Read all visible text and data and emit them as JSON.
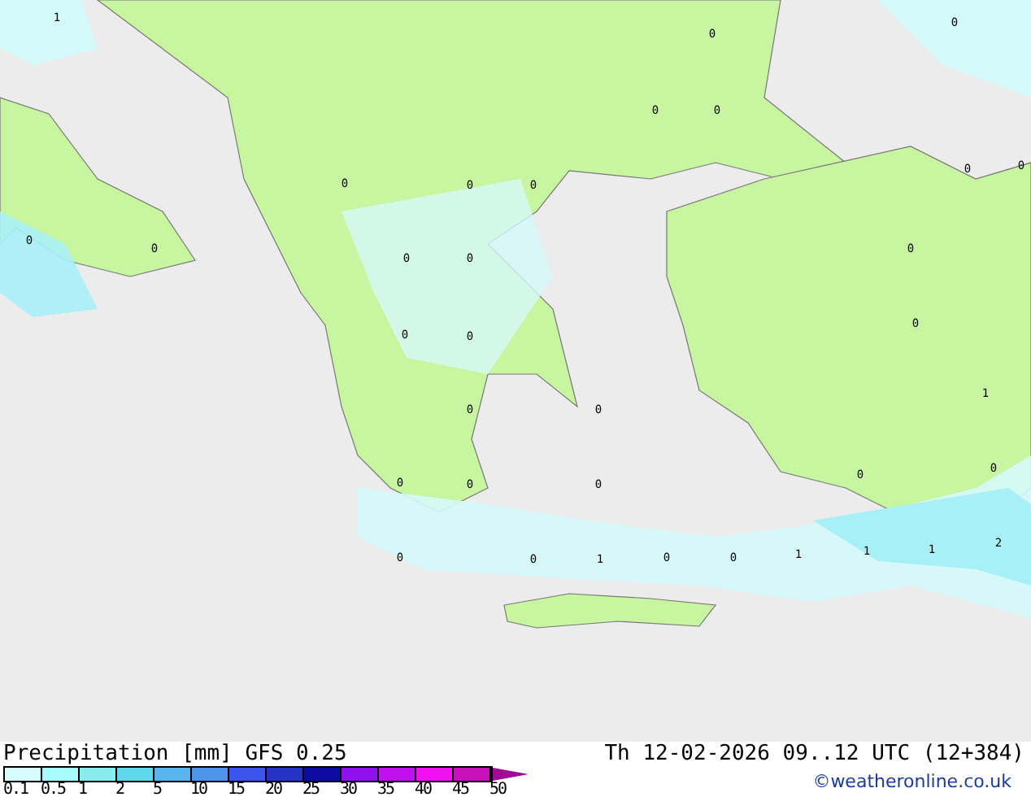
{
  "map": {
    "value_labels": [
      "1",
      "0",
      "0",
      "0",
      "0",
      "0",
      "0",
      "0",
      "0",
      "0",
      "0",
      "0",
      "0",
      "0",
      "0",
      "0",
      "0",
      "0",
      "1",
      "0",
      "0",
      "0",
      "0",
      "0",
      "0",
      "0",
      "0",
      "0",
      "1",
      "0",
      "0",
      "1",
      "1",
      "1",
      "2"
    ]
  },
  "legend": {
    "title": "Precipitation [mm]",
    "model": "GFS 0.25",
    "scale": [
      {
        "label": "0.1",
        "color": "#d8fcfc"
      },
      {
        "label": "0.5",
        "color": "#a8fcfc"
      },
      {
        "label": "1",
        "color": "#88ecec"
      },
      {
        "label": "2",
        "color": "#60d8ec"
      },
      {
        "label": "5",
        "color": "#58b4ec"
      },
      {
        "label": "10",
        "color": "#4c94ec"
      },
      {
        "label": "15",
        "color": "#3c54ec"
      },
      {
        "label": "20",
        "color": "#2434c4"
      },
      {
        "label": "25",
        "color": "#0c0ca0"
      },
      {
        "label": "30",
        "color": "#9010f0"
      },
      {
        "label": "35",
        "color": "#c010f0"
      },
      {
        "label": "40",
        "color": "#f010f0"
      },
      {
        "label": "45",
        "color": "#c810b8"
      },
      {
        "label": "50",
        "color": "#a00898"
      }
    ]
  },
  "valid_time": "Th 12-02-2026 09..12 UTC (12+384)",
  "credit": "©weatheronline.co.uk"
}
